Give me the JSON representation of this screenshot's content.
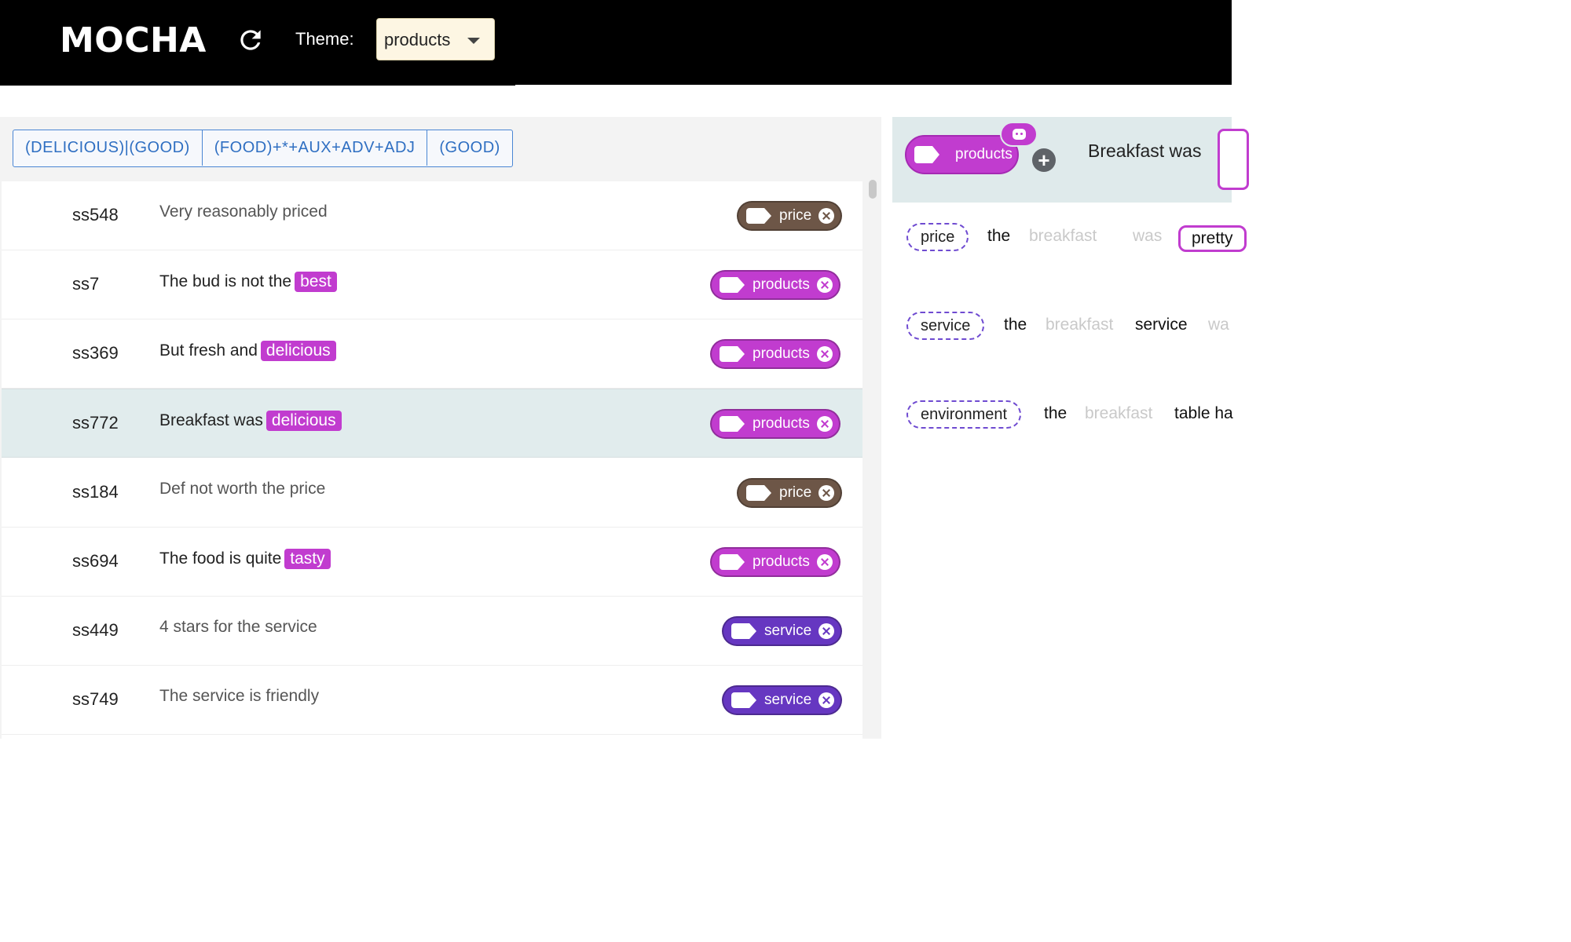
{
  "header": {
    "logo": "MOCHA",
    "theme_label": "Theme:",
    "theme_value": "products"
  },
  "rule_tabs": [
    "(DELICIOUS)|(GOOD)",
    "(FOOD)+*+AUX+ADV+ADJ",
    "(GOOD)"
  ],
  "rows": [
    {
      "id": "ss548",
      "text": "Very reasonably priced",
      "highlight": "",
      "label": "price"
    },
    {
      "id": "ss7",
      "text": "The bud is not the",
      "highlight": "best",
      "label": "products"
    },
    {
      "id": "ss369",
      "text": "But fresh and",
      "highlight": "delicious",
      "label": "products"
    },
    {
      "id": "ss772",
      "text": "Breakfast was",
      "highlight": "delicious",
      "label": "products"
    },
    {
      "id": "ss184",
      "text": "Def not worth the price",
      "highlight": "",
      "label": "price"
    },
    {
      "id": "ss694",
      "text": "The food is quite",
      "highlight": "tasty",
      "label": "products"
    },
    {
      "id": "ss449",
      "text": "4 stars for the service",
      "highlight": "",
      "label": "service"
    },
    {
      "id": "ss749",
      "text": "The service is friendly",
      "highlight": "",
      "label": "service"
    }
  ],
  "right_panel": {
    "selected_theme": "products",
    "sentence": "Breakfast was",
    "patterns": [
      {
        "tag": "price",
        "tokens": [
          "the",
          "breakfast",
          "was",
          "pretty"
        ]
      },
      {
        "tag": "service",
        "tokens": [
          "the",
          "breakfast",
          "service",
          "wa"
        ]
      },
      {
        "tag": "environment",
        "tokens": [
          "the",
          "breakfast",
          "table ha"
        ]
      }
    ]
  },
  "colors": {
    "price": "#6d5647",
    "products": "#c13ccf",
    "service": "#6637c1",
    "rule_blue": "#2f6fc2",
    "selected_row": "#e1eced"
  },
  "icons": {
    "refresh": "refresh-icon",
    "dropdown": "caret-down-icon",
    "tag": "label-tag-icon",
    "remove": "close-circle-icon",
    "robot": "robot-icon",
    "add": "plus-circle-icon"
  }
}
